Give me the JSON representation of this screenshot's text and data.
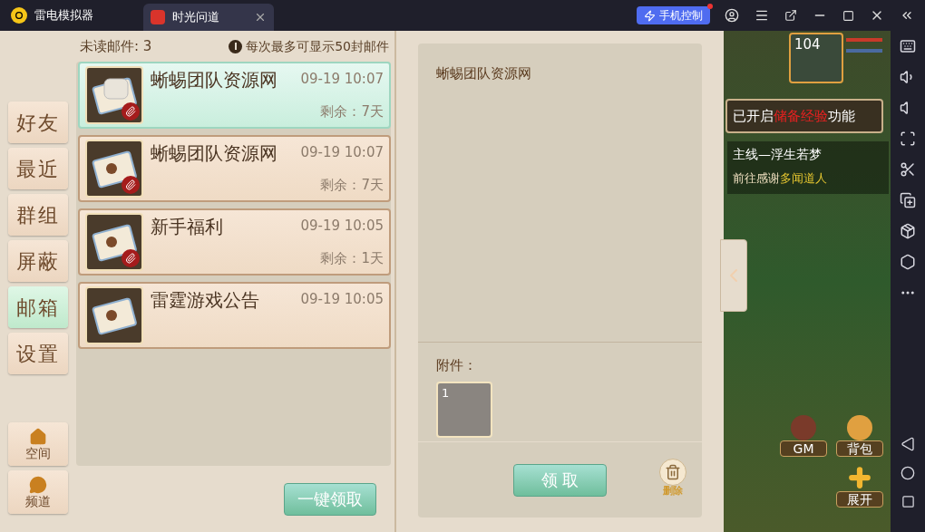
{
  "window": {
    "app_name": "雷电模拟器",
    "tab": {
      "title": "时光问道",
      "selected": true
    },
    "phone_control": "手机控制"
  },
  "side_nav": [
    {
      "label": "好友",
      "selected": false
    },
    {
      "label": "最近",
      "selected": false
    },
    {
      "label": "群组",
      "selected": false
    },
    {
      "label": "屏蔽",
      "selected": false
    },
    {
      "label": "邮箱",
      "selected": true
    },
    {
      "label": "设置",
      "selected": false
    }
  ],
  "side_nav_bottom": [
    {
      "label": "空间",
      "kind": "home"
    },
    {
      "label": "频道",
      "kind": "chat"
    }
  ],
  "mail": {
    "unread_label": "未读邮件: 3",
    "notice": "每次最多可显示50封邮件",
    "claim_all": "一键领取",
    "items": [
      {
        "sender": "蜥蜴团队资源网",
        "time": "09-19 10:07",
        "remaining": "剩余：7天",
        "attachment": true,
        "opened": true,
        "selected": true
      },
      {
        "sender": "蜥蜴团队资源网",
        "time": "09-19 10:07",
        "remaining": "剩余：7天",
        "attachment": true,
        "opened": false,
        "selected": false
      },
      {
        "sender": "新手福利",
        "time": "09-19 10:05",
        "remaining": "剩余：1天",
        "attachment": true,
        "opened": false,
        "selected": false
      },
      {
        "sender": "雷霆游戏公告",
        "time": "09-19 10:05",
        "attachment": false,
        "opened": false,
        "selected": false
      }
    ]
  },
  "detail": {
    "body": "蜥蜴团队资源网",
    "attachments_label": "附件：",
    "attachments": [
      {
        "count": "1"
      }
    ],
    "claim": "领 取",
    "delete": "删除"
  },
  "game": {
    "level": "104",
    "notice": {
      "before": "已开启",
      "highlight": "储备经验",
      "after": "功能"
    },
    "quest_title": "主线—浮生若梦",
    "quest_task": "前往感谢",
    "quest_target": "多闻道人",
    "buttons": [
      {
        "label": "GM",
        "kind": "gm"
      },
      {
        "label": "背包",
        "kind": "bag"
      },
      {
        "label": "展开",
        "kind": "expand"
      }
    ]
  }
}
